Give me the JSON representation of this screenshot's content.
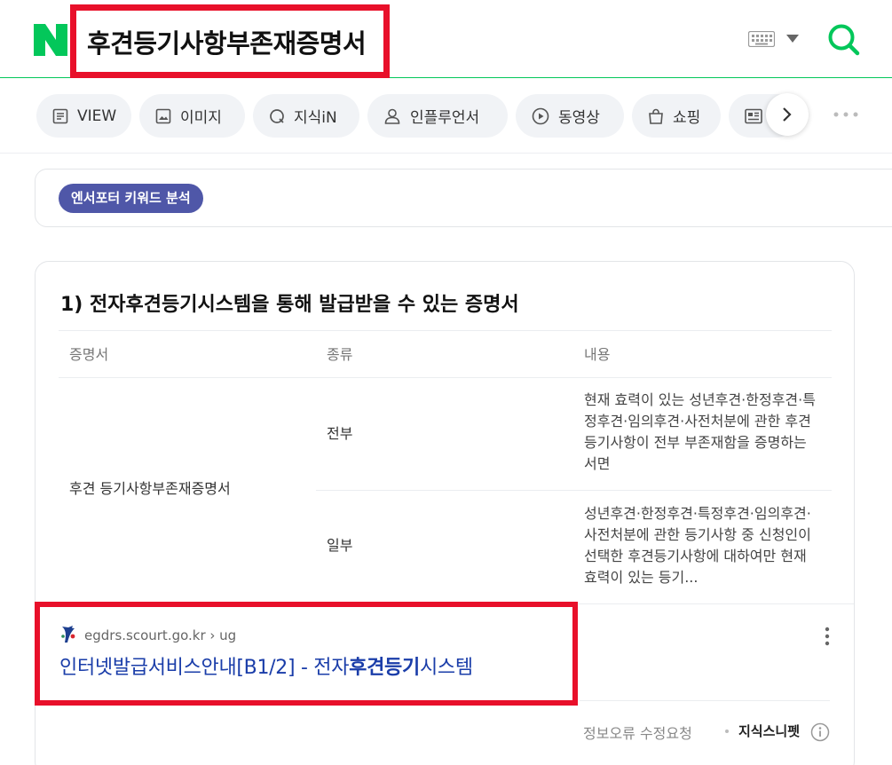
{
  "header": {
    "logo_letter": "N",
    "query": "후견등기사항부존재증명서",
    "colors": {
      "brand": "#03c75a",
      "highlight": "#e8102a"
    }
  },
  "tabs": [
    {
      "label": "VIEW",
      "icon": "document-icon"
    },
    {
      "label": "이미지",
      "icon": "image-icon"
    },
    {
      "label": "지식iN",
      "icon": "q-bubble-icon"
    },
    {
      "label": "인플루언서",
      "icon": "person-icon"
    },
    {
      "label": "동영상",
      "icon": "play-icon"
    },
    {
      "label": "쇼핑",
      "icon": "shopping-bag-icon"
    },
    {
      "label": "",
      "icon": "news-icon"
    }
  ],
  "keyword_analysis": {
    "chip_label": "엔서포터 키워드 분석"
  },
  "snippet": {
    "title": "1) 전자후견등기시스템을 통해 발급받을 수 있는 증명서",
    "table": {
      "headers": [
        "증명서",
        "종류",
        "내용"
      ],
      "certificate": "후견 등기사항부존재증명서",
      "rows": [
        {
          "type": "전부",
          "content": "현재 효력이 있는 성년후견·한정후견·특정후견·임의후견·사전처분에 관한 후견등기사항이 전부 부존재함을 증명하는 서면"
        },
        {
          "type": "일부",
          "content": "성년후견·한정후견·특정후견·임의후견·사전처분에 관한 등기사항 중 신청인이 선택한 후견등기사항에 대하여만 현재 효력이 있는 등기..."
        }
      ]
    },
    "source": {
      "url": "egdrs.scourt.go.kr › ug",
      "title_pre": "인터넷발급서비스안내[B1/2] - 전자",
      "title_bold": "후견등기",
      "title_post": "시스템"
    },
    "footer": {
      "report": "정보오류 수정요청",
      "label": "지식스니펫"
    }
  }
}
